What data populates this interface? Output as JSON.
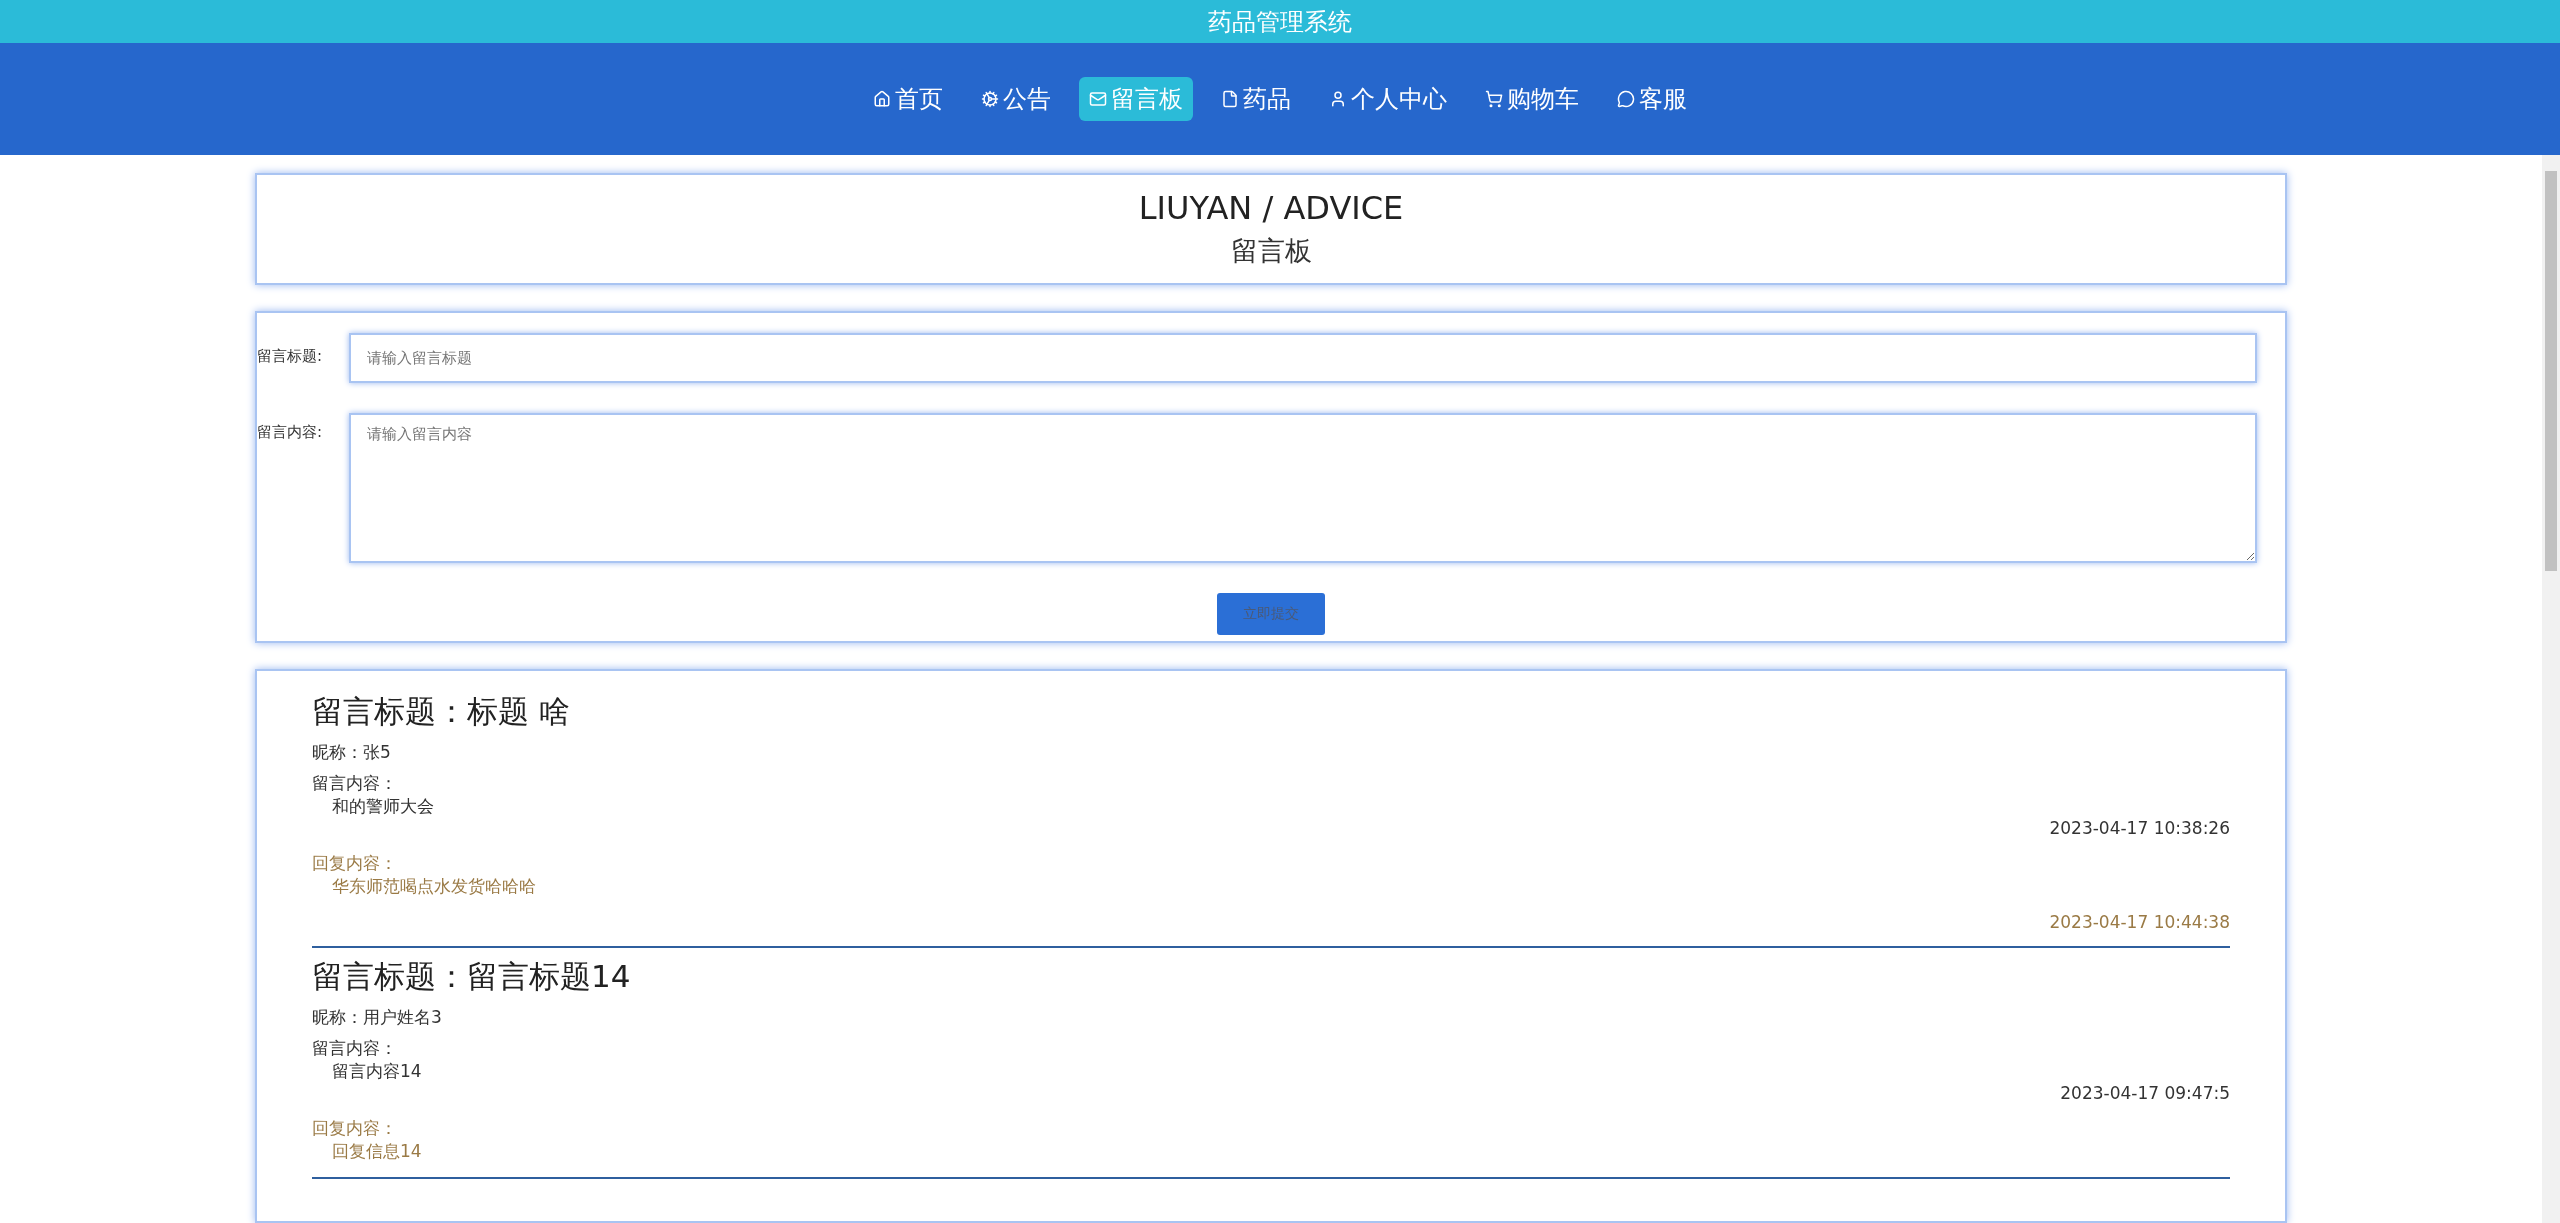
{
  "site_title": "药品管理系统",
  "nav": [
    {
      "label": "首页",
      "kind": "home",
      "selected": false
    },
    {
      "label": "公告",
      "kind": "gear",
      "selected": false
    },
    {
      "label": "留言板",
      "kind": "mail",
      "selected": true
    },
    {
      "label": "药品",
      "kind": "file",
      "selected": false
    },
    {
      "label": "个人中心",
      "kind": "user",
      "selected": false
    },
    {
      "label": "购物车",
      "kind": "cart",
      "selected": false
    },
    {
      "label": "客服",
      "kind": "chat",
      "selected": false
    }
  ],
  "page_header": {
    "title": "LIUYAN / ADVICE",
    "subtitle": "留言板"
  },
  "form": {
    "fields": [
      {
        "label": "留言标题:",
        "placeholder": "请输入留言标题",
        "kind": "input"
      },
      {
        "label": "留言内容:",
        "placeholder": "请输入留言内容",
        "kind": "textarea"
      }
    ],
    "submit": "立即提交"
  },
  "messages": [
    {
      "title": "留言标题：标题 啥",
      "nickname": "昵称：张5",
      "content_label": "留言内容：",
      "content": "和的警师大会",
      "time": "2023-04-17 10:38:26",
      "reply_label": "回复内容：",
      "reply": "华东师范喝点水发货哈哈哈",
      "reply_time": "2023-04-17 10:44:38"
    },
    {
      "title": "留言标题：留言标题14",
      "nickname": "昵称：用户姓名3",
      "content_label": "留言内容：",
      "content": "留言内容14",
      "time": "2023-04-17 09:47:5",
      "reply_label": "回复内容：",
      "reply": "回复信息14"
    }
  ]
}
